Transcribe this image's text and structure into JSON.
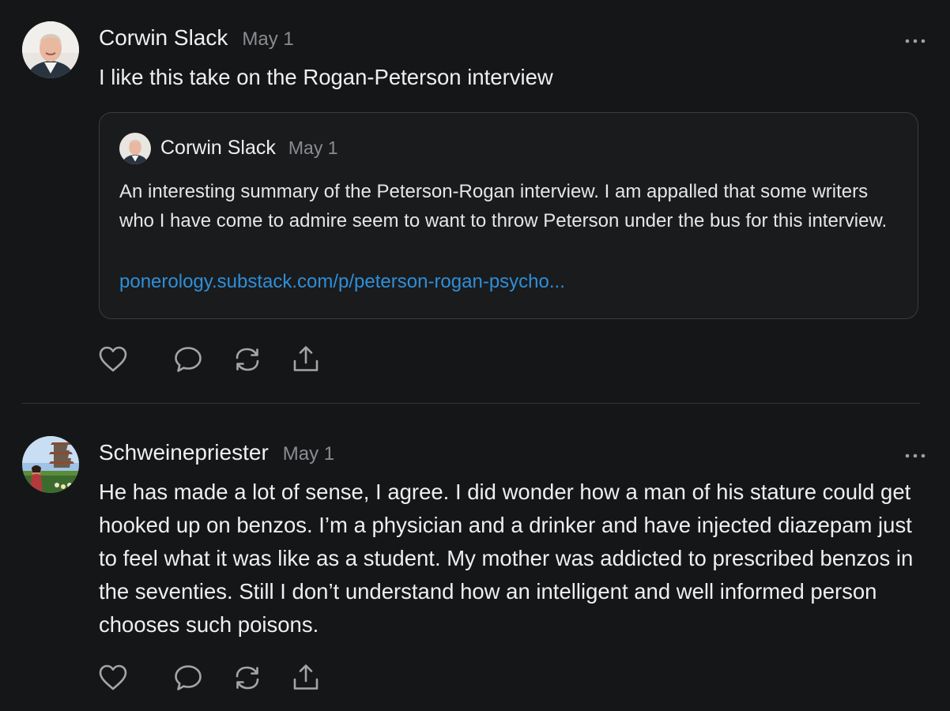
{
  "posts": [
    {
      "author": "Corwin Slack",
      "date": "May 1",
      "text": "I like this take on the Rogan-Peterson interview",
      "quote": {
        "author": "Corwin Slack",
        "date": "May 1",
        "text": "An interesting summary of the Peterson-Rogan interview. I am appalled that some writers who I have come to admire seem to want to throw Peterson under the bus for this interview.",
        "link": "ponerology.substack.com/p/peterson-rogan-psycho..."
      }
    },
    {
      "author": "Schweinepriester",
      "date": "May 1",
      "text": "He has made a lot of sense, I agree. I did wonder how a man of his stature could get hooked up on benzos. I’m a physician and a drinker and have injected diazepam just to feel what it was like as a student. My mother was addicted to prescribed benzos in the seventies. Still I don’t understand how an intelligent and well informed person chooses such poisons."
    }
  ],
  "icons": {
    "more": "more-horizontal-icon",
    "like": "heart-icon",
    "comment": "comment-bubble-icon",
    "restack": "restack-icon",
    "share": "share-icon"
  },
  "colors": {
    "background": "#151618",
    "link": "#2e8fd8",
    "muted": "#8b8c90"
  }
}
